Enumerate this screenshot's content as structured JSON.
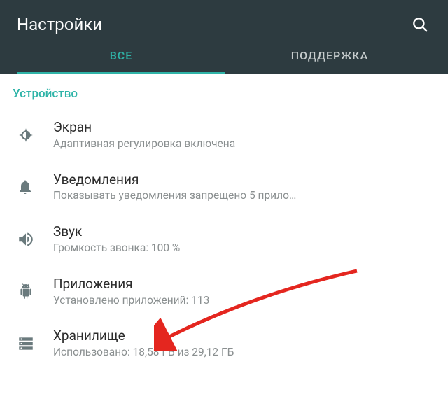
{
  "header": {
    "title": "Настройки"
  },
  "tabs": {
    "all": "ВСЕ",
    "support": "ПОДДЕРЖКА"
  },
  "section": {
    "device": "Устройство"
  },
  "items": {
    "display": {
      "title": "Экран",
      "sub": "Адаптивная регулировка включена"
    },
    "notifications": {
      "title": "Уведомления",
      "sub": "Показывать уведомления запрещено 5 прило…"
    },
    "sound": {
      "title": "Звук",
      "sub": "Громкость звонка: 100 %"
    },
    "apps": {
      "title": "Приложения",
      "sub": "Установлено приложений: 113"
    },
    "storage": {
      "title": "Хранилище",
      "sub": "Использовано: 18,58 ГБ из 29,12 ГБ"
    }
  },
  "colors": {
    "accent": "#2fb4a8",
    "appbar": "#2d3b40",
    "arrow": "#e4261f"
  }
}
